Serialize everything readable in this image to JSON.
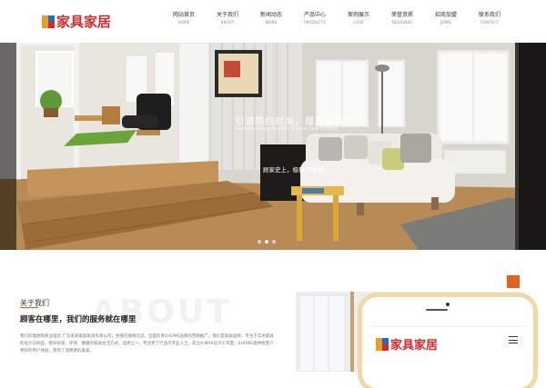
{
  "brand": {
    "logo_text": "家具家居",
    "colors": {
      "red": "#d8282a",
      "orange": "#e8601c",
      "yellow": "#e8a020",
      "blue": "#1e6ec8"
    }
  },
  "nav": {
    "items": [
      {
        "cn": "网站首页",
        "en": "HOME"
      },
      {
        "cn": "关于我们",
        "en": "ABOUT"
      },
      {
        "cn": "新闻动态",
        "en": "NEWS"
      },
      {
        "cn": "产品中心",
        "en": "PRODUCTS"
      },
      {
        "cn": "案例展示",
        "en": "CASE"
      },
      {
        "cn": "荣誉资质",
        "en": "DESIGNER"
      },
      {
        "cn": "招商加盟",
        "en": "JOINS"
      },
      {
        "cn": "联系我们",
        "en": "CONTACT"
      }
    ]
  },
  "banner": {
    "slogan": "引领简约时尚，履现全新舒适",
    "slogan_en": "Lead the simple fashion, ensure new comfort",
    "slogan2": "顾家史上，极致·舒软款",
    "slide_count": 3,
    "active_slide": 2
  },
  "about": {
    "watermark": "ABOUT",
    "title": "关于我们",
    "subtitle": "顾客在哪里，我们的服务就在哪里",
    "text": "我们的理想和商业理念 广东某某家居家具有限公司，坐落在顺德北滘，全面负责EHOME品牌的营销推广，我们是家居品牌，专注于实木家具的设计与制造，倡导舒适、环保、健康的家居生活方式，品牌之一，专注更了行业内专业人士，成立A-MAX设计工作室，EHOME提供给客户更好的用户体验，受到了消费者的喜爱。"
  },
  "phone": {
    "logo_text": "家具家居",
    "menu_icon": "hamburger-menu-icon"
  }
}
